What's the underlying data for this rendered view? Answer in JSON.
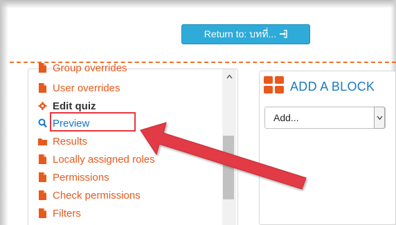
{
  "header": {
    "return_label": "Return to: บทที่...",
    "return_icon": "sign-in-icon"
  },
  "navigation": {
    "items": [
      {
        "label": "Group overrides",
        "icon": "file-icon",
        "style": "link"
      },
      {
        "label": "User overrides",
        "icon": "file-icon",
        "style": "link"
      },
      {
        "label": "Edit quiz",
        "icon": "gear-icon",
        "style": "bold"
      },
      {
        "label": "Preview",
        "icon": "search-icon",
        "style": "active"
      },
      {
        "label": "Results",
        "icon": "folder-icon",
        "style": "link"
      },
      {
        "label": "Locally assigned roles",
        "icon": "file-icon",
        "style": "link"
      },
      {
        "label": "Permissions",
        "icon": "file-icon",
        "style": "link"
      },
      {
        "label": "Check permissions",
        "icon": "file-icon",
        "style": "link"
      },
      {
        "label": "Filters",
        "icon": "file-icon",
        "style": "link"
      }
    ]
  },
  "block": {
    "title": "ADD A BLOCK",
    "icon": "blocks-grid-icon",
    "select_value": "Add..."
  },
  "colors": {
    "accent_orange": "#e8591c",
    "link_blue": "#1177cc",
    "button_blue": "#2eabd8",
    "highlight_red": "#e8333d"
  }
}
